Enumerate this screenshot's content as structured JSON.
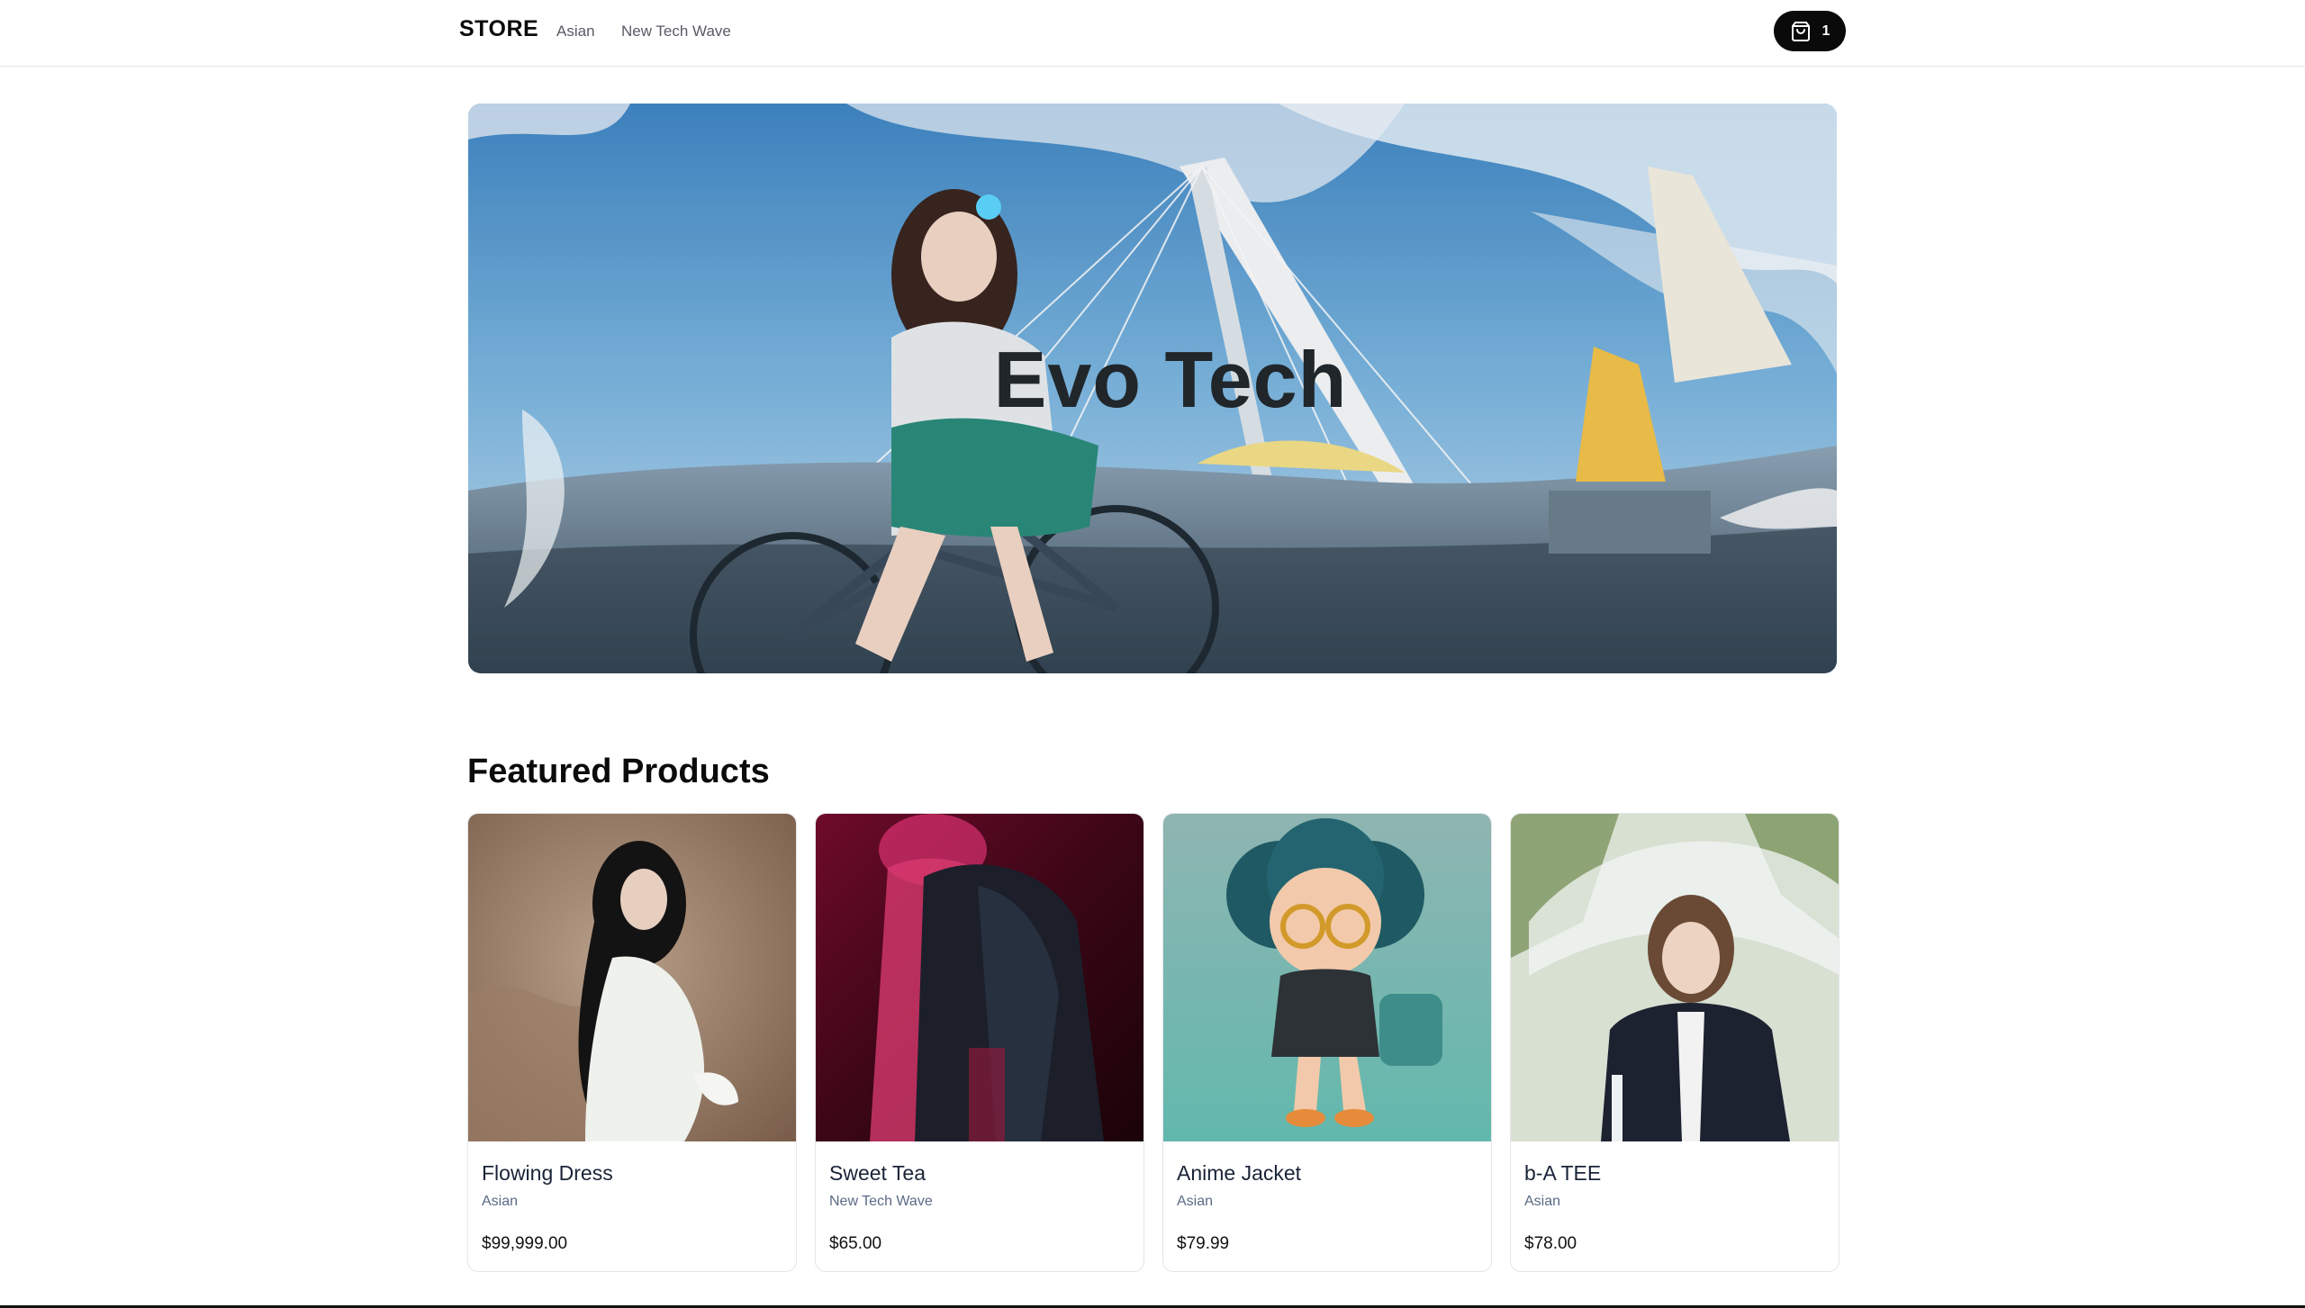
{
  "header": {
    "brand": "STORE",
    "nav": [
      "Asian",
      "New Tech Wave"
    ],
    "cart_count": "1"
  },
  "hero": {
    "title": "Evo Tech"
  },
  "featured": {
    "title": "Featured Products",
    "products": [
      {
        "name": "Flowing Dress",
        "category": "Asian",
        "price": "$99,999.00"
      },
      {
        "name": "Sweet Tea",
        "category": "New Tech Wave",
        "price": "$65.00"
      },
      {
        "name": "Anime Jacket",
        "category": "Asian",
        "price": "$79.99"
      },
      {
        "name": "b-A TEE",
        "category": "Asian",
        "price": "$78.00"
      }
    ]
  },
  "icons": {
    "cart": "shopping-bag-icon"
  }
}
